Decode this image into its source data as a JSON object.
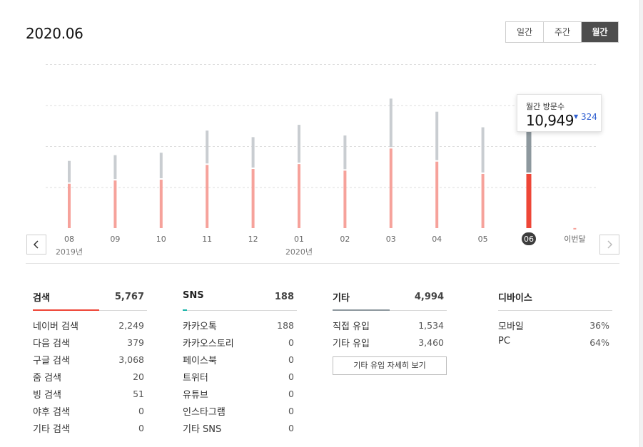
{
  "header": {
    "period": "2020.06",
    "tabs": [
      {
        "label": "일간",
        "active": false
      },
      {
        "label": "주간",
        "active": false
      },
      {
        "label": "월간",
        "active": true
      }
    ]
  },
  "chart_data": {
    "type": "bar",
    "stacked": true,
    "categories": [
      "08",
      "09",
      "10",
      "11",
      "12",
      "01",
      "02",
      "03",
      "04",
      "05",
      "06",
      "이번달"
    ],
    "year_labels": [
      {
        "label": "2019년",
        "at": "08"
      },
      {
        "label": "2020년",
        "at": "01"
      }
    ],
    "selected": "06",
    "series": [
      {
        "color": "#f6a29b",
        "selected_color": "#ee4637",
        "values": [
          5500,
          5900,
          6000,
          7800,
          7300,
          7900,
          7100,
          9800,
          8200,
          6700,
          6700,
          100
        ]
      },
      {
        "color": "#c9cdd1",
        "selected_color": "#8d989e",
        "values": [
          2700,
          3000,
          3200,
          4100,
          3800,
          4700,
          4200,
          6000,
          6000,
          5600,
          5200,
          0
        ]
      }
    ],
    "ylim": [
      0,
      20000
    ],
    "grid": true,
    "tooltip": {
      "label": "월간 방문수",
      "value": "10,949",
      "diff": "324",
      "diff_direction": "down"
    }
  },
  "nav": {
    "prev_icon": "chevron-left-icon",
    "next_icon": "chevron-right-icon"
  },
  "breakdown": {
    "search": {
      "title": "검색",
      "total": "5,767",
      "color": "#ee4637",
      "share": 0.58,
      "items": [
        {
          "label": "네이버 검색",
          "value": "2,249"
        },
        {
          "label": "다음 검색",
          "value": "379"
        },
        {
          "label": "구글 검색",
          "value": "3,068"
        },
        {
          "label": "줌 검색",
          "value": "20"
        },
        {
          "label": "빙 검색",
          "value": "51"
        },
        {
          "label": "야후 검색",
          "value": "0"
        },
        {
          "label": "기타 검색",
          "value": "0"
        }
      ]
    },
    "sns": {
      "title": "SNS",
      "total": "188",
      "color": "#19b5a9",
      "share": 0.04,
      "items": [
        {
          "label": "카카오톡",
          "value": "188"
        },
        {
          "label": "카카오스토리",
          "value": "0"
        },
        {
          "label": "페이스북",
          "value": "0"
        },
        {
          "label": "트위터",
          "value": "0"
        },
        {
          "label": "유튜브",
          "value": "0"
        },
        {
          "label": "인스타그램",
          "value": "0"
        },
        {
          "label": "기타 SNS",
          "value": "0"
        }
      ]
    },
    "etc": {
      "title": "기타",
      "total": "4,994",
      "color": "#8d989e",
      "share": 0.5,
      "items": [
        {
          "label": "직접 유입",
          "value": "1,534"
        },
        {
          "label": "기타 유입",
          "value": "3,460"
        }
      ],
      "detail_button": "기타 유입 자세히 보기"
    },
    "device": {
      "title": "디바이스",
      "items": [
        {
          "label": "모바일",
          "value": "36%"
        },
        {
          "label": "PC",
          "value": "64%"
        }
      ]
    }
  }
}
